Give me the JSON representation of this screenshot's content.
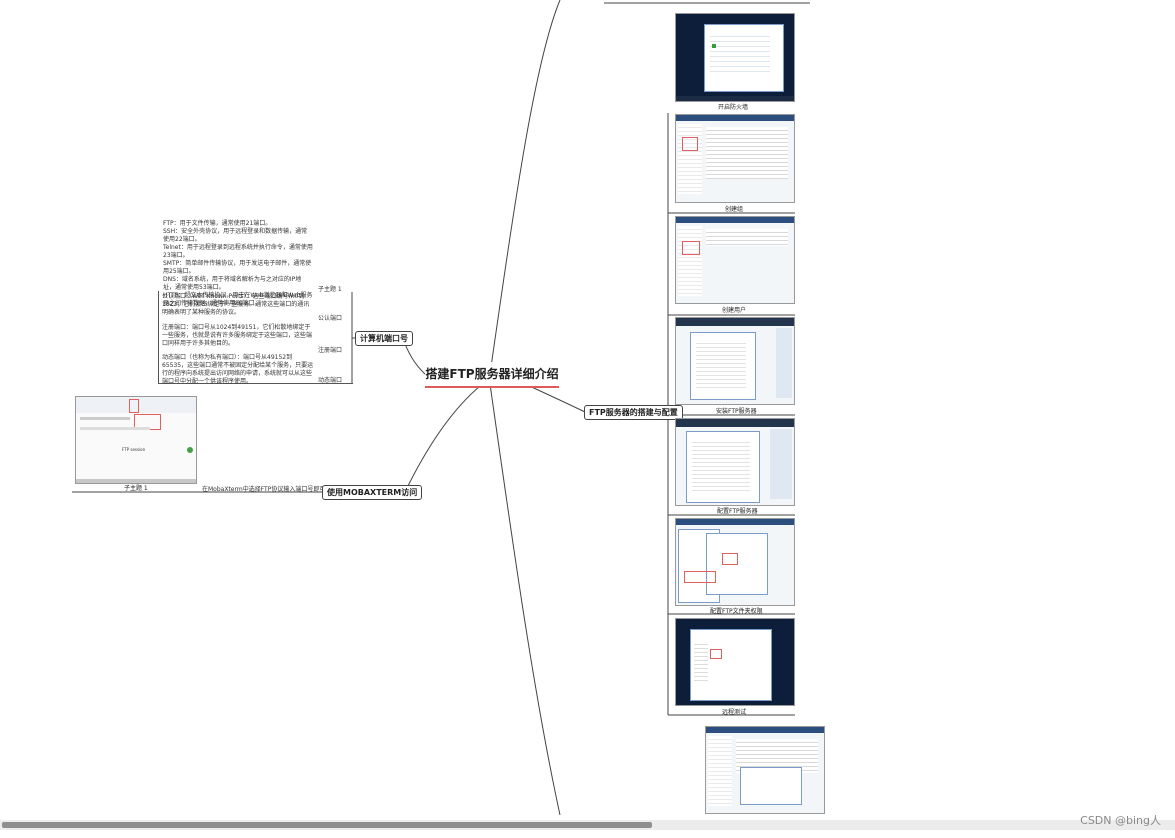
{
  "root": {
    "title": "搭建FTP服务器详细介绍"
  },
  "left": {
    "ports": {
      "label": "计算机端口号",
      "topic_label": "子主题 1",
      "protocol_text": "FTP：用于文件传输，通常使用21端口。\nSSH：安全外壳协议，用于远程登录和数据传输，通常使用22端口。\nTelnet：用于远程登录到远程系统并执行命令，通常使用23端口。\nSMTP：简单邮件传输协议，用于发送电子邮件，通常使用25端口。\nDNS：域名系统，用于将域名解析为与之对应的IP地址，通常使用53端口。\nHTTP：超文本传输协议，用于在Web浏览器和Web服务器之间传输数据，通常使用80端口。",
      "items": [
        {
          "label": "公认端口",
          "text": "公认端口（Well Known Ports）：这些端口编号从0到1023，它们紧密绑定于一些服务。通常这些端口的通讯明确表明了某种服务的协议。"
        },
        {
          "label": "注册端口",
          "text": "注册端口：端口号从1024到49151，它们松散地绑定于一些服务，也就是说有许多服务绑定于这些端口，这些端口同样用于许多其他目的。"
        },
        {
          "label": "动态端口",
          "text": "动态端口（也称为私有端口）：端口号从49152到65535，这些端口通常不被固定分配给某个服务，只要运行的程序向系统提出访问网络的申请，系统就可以从这些端口号中分配一个供该程序使用。"
        }
      ]
    },
    "moba": {
      "label": "使用MOBAXTERM访问",
      "item_label": "在MobaXterm中选择FTP协议输入端口号即可",
      "thumb_caption": "子主题 1",
      "thumb_text": "FTP session"
    }
  },
  "right": {
    "label": "FTP服务器的搭建与配置",
    "thumbs": [
      {
        "caption": "开启防火墙"
      },
      {
        "caption": "创建组"
      },
      {
        "caption": "创建用户"
      },
      {
        "caption": "安装FTP服务器"
      },
      {
        "caption": "配置FTP服务器"
      },
      {
        "caption": "配置FTP文件夹权限"
      },
      {
        "caption": "远程测试"
      },
      {
        "caption": ""
      }
    ]
  },
  "footer": {
    "watermark": "CSDN @bing人"
  }
}
